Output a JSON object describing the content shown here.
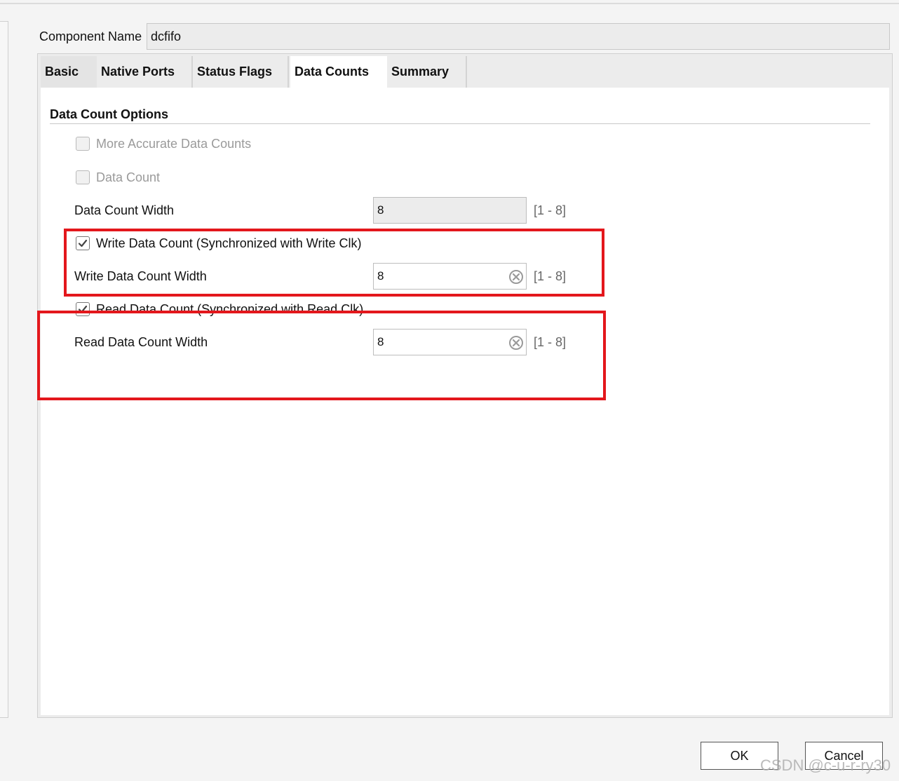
{
  "component": {
    "label": "Component Name",
    "value": "dcfifo"
  },
  "tabs": [
    {
      "label": "Basic"
    },
    {
      "label": "Native Ports"
    },
    {
      "label": "Status Flags"
    },
    {
      "label": "Data Counts"
    },
    {
      "label": "Summary"
    }
  ],
  "active_tab": "Data Counts",
  "section": {
    "title": "Data Count Options"
  },
  "options": {
    "more_accurate": {
      "label": "More Accurate Data Counts",
      "checked": false,
      "enabled": false
    },
    "data_count": {
      "label": "Data Count",
      "checked": false,
      "enabled": false
    },
    "data_count_width": {
      "label": "Data Count Width",
      "value": "8",
      "range": "[1 - 8]",
      "enabled": false
    },
    "write_data_count": {
      "label": "Write Data Count (Synchronized with Write Clk)",
      "checked": true
    },
    "write_data_count_width": {
      "label": "Write Data Count Width",
      "value": "8",
      "range": "[1 - 8]"
    },
    "read_data_count": {
      "label": "Read Data Count (Synchronized with Read Clk)",
      "checked": true
    },
    "read_data_count_width": {
      "label": "Read Data Count Width",
      "value": "8",
      "range": "[1 - 8]"
    }
  },
  "buttons": {
    "ok": "OK",
    "cancel": "Cancel"
  },
  "watermark": "CSDN @c-u-r-ry30",
  "colors": {
    "highlight": "#e3171c",
    "active_tab": "#ffffff",
    "tab_bar": "#ececec"
  }
}
